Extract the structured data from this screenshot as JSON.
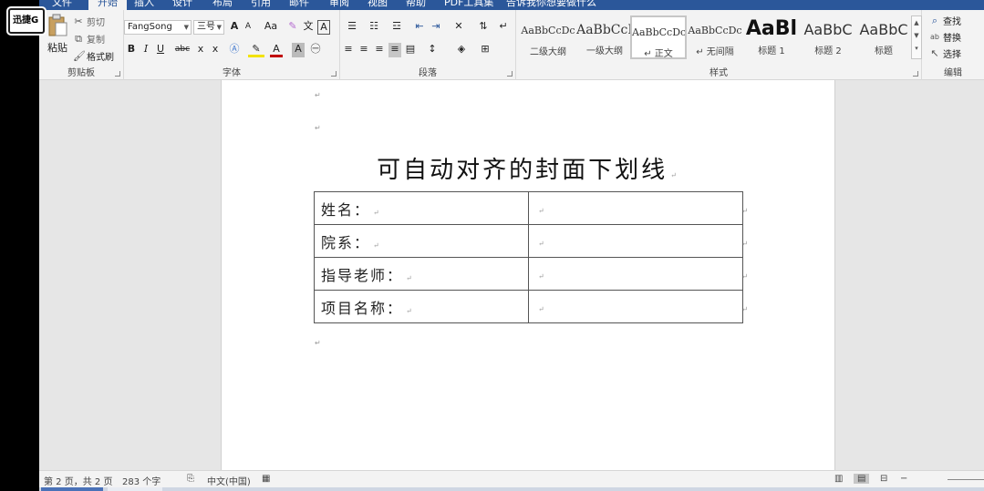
{
  "app_badge": "迅捷G",
  "tabs": [
    "文件",
    "开始",
    "插入",
    "设计",
    "布局",
    "引用",
    "邮件",
    "审阅",
    "视图",
    "帮助",
    "PDF工具集",
    "告诉我你想要做什么"
  ],
  "active_tab": "开始",
  "clipboard": {
    "paste": "粘贴",
    "cut": "剪切",
    "copy": "复制",
    "format_painter": "格式刷",
    "label": "剪贴板"
  },
  "font": {
    "family": "FangSong",
    "size": "三号",
    "label": "字体",
    "grow": "A",
    "shrink": "A",
    "case": "Aa",
    "bold": "B",
    "italic": "I",
    "underline": "U",
    "strike": "abc",
    "subscript": "x",
    "superscript": "x",
    "phonetic": "文",
    "border_char": "A"
  },
  "paragraph": {
    "label": "段落"
  },
  "styles": {
    "label": "样式",
    "items": [
      {
        "sample": "AaBbCcDc",
        "name": "二级大纲"
      },
      {
        "sample": "AaBbCcI",
        "name": "一级大纲"
      },
      {
        "sample": "AaBbCcDc",
        "name": "正文"
      },
      {
        "sample": "AaBbCcDc",
        "name": "无间隔"
      },
      {
        "sample": "AaBl",
        "name": "标题 1"
      },
      {
        "sample": "AaBbC",
        "name": "标题 2"
      },
      {
        "sample": "AaBbC",
        "name": "标题"
      }
    ],
    "selected_index": 2
  },
  "editing": {
    "label": "编辑",
    "find": "查找",
    "replace": "替换",
    "select": "选择"
  },
  "document": {
    "title": "可自动对齐的封面下划线",
    "table": [
      {
        "label": "姓名：",
        "value": ""
      },
      {
        "label": "院系：",
        "value": ""
      },
      {
        "label": "指导老师：",
        "value": ""
      },
      {
        "label": "项目名称：",
        "value": ""
      }
    ]
  },
  "status": {
    "page": "第 2 页，共 2 页",
    "words": "283 个字",
    "language": "中文(中国)"
  },
  "colors": {
    "ribbon_blue": "#2b579a",
    "font_highlight": "#f2e200",
    "font_color": "#c00000"
  }
}
